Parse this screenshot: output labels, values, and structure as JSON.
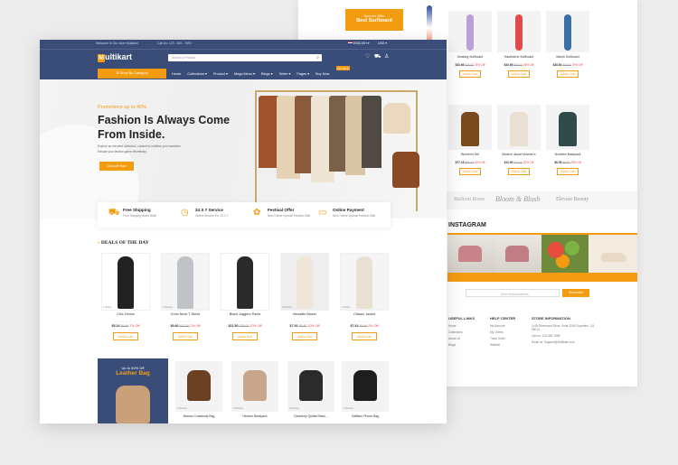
{
  "back": {
    "promo_small": "Special Offer",
    "promo_big": "Best Surfboard",
    "products_top": [
      {
        "name": "Seabing Surfboard",
        "price": "$33.66",
        "old": "$45.00",
        "off": "25% Off",
        "btn": "Add to Cart"
      },
      {
        "name": "Hawthorne Surfboard",
        "price": "$33.66",
        "old": "$45.00",
        "off": "25% Off",
        "btn": "Add to Cart"
      },
      {
        "name": "Marsh Surfboard",
        "price": "$28.60",
        "old": "$39.00",
        "off": "25% Off",
        "btn": "Add to Cart"
      }
    ],
    "products_mid": [
      {
        "name": "Women's Set",
        "price": "$77.18",
        "old": "$93.00",
        "off": "15% Off",
        "btn": "Add to Cart"
      },
      {
        "name": "Modern Jacket Women's",
        "price": "$13.00",
        "old": "$17.00",
        "off": "20% Off",
        "btn": "Add to Cart"
      },
      {
        "name": "Nordtren Backpack",
        "price": "$6.55",
        "old": "$9.00",
        "off": "25% Off",
        "btn": "Add to Cart"
      }
    ],
    "brands": [
      "Radiant Roses",
      "Bloom & Blush",
      "Elevate Beauty"
    ],
    "instagram_title": "INSTAGRAM",
    "newsletter_placeholder": "Enter Email Address",
    "newsletter_btn": "Subscribe",
    "footer": {
      "col1_title": "USEFUL LINKS",
      "col1": [
        "Home",
        "Collections",
        "About Us",
        "Blogs"
      ],
      "col2_title": "HELP CENTER",
      "col2": [
        "My Account",
        "My Orders",
        "Track Order",
        "Wishlist"
      ],
      "col3_title": "STORE INFORMATION",
      "col3": [
        "1418 Riverwood Drive, Suite 3245 Cupertino, CA 95014",
        "Call us: 123-456-7898",
        "Email us: Support@Multikart.com"
      ]
    }
  },
  "front": {
    "topbar": {
      "welcome": "Welcome to Our store Multikart",
      "call": "Call Us: 123 - 456 - 7890",
      "language": "ENGLISH",
      "currency": "USD"
    },
    "logo_initial": "M",
    "logo_rest": "ultikart",
    "search_placeholder": "Search a Product",
    "category_btn": "Shop By Category",
    "nav": [
      "Home",
      "Collections",
      "Product",
      "Mega Menu",
      "Blogs",
      "Seller",
      "Pages",
      "Buy Now"
    ],
    "nav_badge": "ON SALE",
    "hero": {
      "promo": "Promotions up to 40%",
      "title_line1": "Fashion Is Always Come",
      "title_line2": "From Inside.",
      "desc_line1": "Explore an elevated collection, curated to redefine your wardrobe.",
      "desc_line2": "Elevate your fashion game effortlessly.",
      "btn": "Discover Now"
    },
    "services": [
      {
        "title": "Free Shipping",
        "sub": "Free Shipping World Wide",
        "icon": "truck-icon"
      },
      {
        "title": "24 X 7 Service",
        "sub": "Online Service For 24 X 7",
        "icon": "clock-icon"
      },
      {
        "title": "Festival Offer",
        "sub": "New Online Special Festival Offer",
        "icon": "gift-icon"
      },
      {
        "title": "Online Payment",
        "sub": "New Online Special Festival Offer",
        "icon": "card-icon"
      }
    ],
    "deals_title": "DEALS OF THE DAY",
    "deals": [
      {
        "name": "Chic Denim",
        "price": "$5.24",
        "old": "$6.86",
        "off": "7% Off",
        "btn": "Add to Cart",
        "badge": "1 Piece"
      },
      {
        "name": "Crew Neck T-Shirts",
        "price": "$9.80",
        "old": "$10.36",
        "off": "2% Off",
        "btn": "Add to Cart",
        "badge": "1 Pieces"
      },
      {
        "name": "Black Joggers Pants",
        "price": "$22.50",
        "old": "$25.00",
        "off": "10% Off",
        "btn": "Add to Cart",
        "badge": ""
      },
      {
        "name": "Versatile Blazer",
        "price": "$7.92",
        "old": "$8.80",
        "off": "10% Off",
        "btn": "Add to Cart",
        "badge": "1 Pieces"
      },
      {
        "name": "Classic Jacket",
        "price": "$7.64",
        "old": "$8.40",
        "off": "5% Off",
        "btn": "Add to Cart",
        "badge": "1 Piece"
      }
    ],
    "banner": {
      "small": "Up to 50% Off",
      "big": "Leather Bag"
    },
    "bags": [
      {
        "name": "Barrow Crossbody Bag",
        "badge": "1 Pieces"
      },
      {
        "name": "Heaven Backpack",
        "badge": "1 Pieces"
      },
      {
        "name": "Dewberry Quilted Back...",
        "badge": "1 Pieces"
      },
      {
        "name": "Saffiano Phone Bag",
        "badge": "1 Pieces"
      }
    ]
  }
}
